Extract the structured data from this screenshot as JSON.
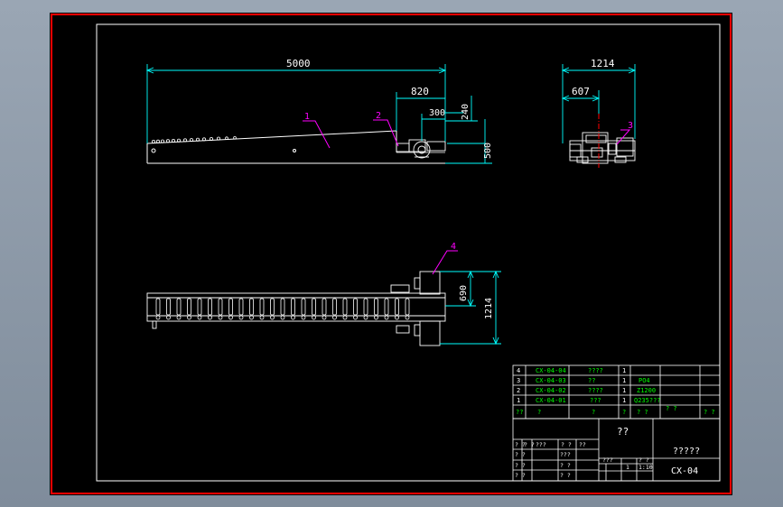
{
  "drawing": {
    "colors": {
      "frame_outer": "#ff0000",
      "frame_inner": "#ffffff",
      "dimension": "#00ffff",
      "leader": "#ff00ff",
      "geometry": "#ffffff",
      "table_text": "#00ff00",
      "background": "#000000"
    },
    "side_view": {
      "dim_length": "5000",
      "dim_820": "820",
      "dim_300": "300",
      "dim_240": "240",
      "dim_500": "500",
      "balloon_1": "1",
      "balloon_2": "2"
    },
    "end_view": {
      "dim_1214": "1214",
      "dim_607": "607",
      "balloon_3": "3"
    },
    "plan_view": {
      "dim_690": "690",
      "dim_1214": "1214",
      "balloon_4": "4"
    },
    "bom": {
      "rows": [
        {
          "no": "4",
          "code": "CX-04-04",
          "name": "????",
          "qty": "1",
          "material": "",
          "note": ""
        },
        {
          "no": "3",
          "code": "CX-04-03",
          "name": "??",
          "qty": "1",
          "material": "PO4",
          "note": ""
        },
        {
          "no": "2",
          "code": "CX-04-02",
          "name": "????",
          "qty": "1",
          "material": "Z1200",
          "note": ""
        },
        {
          "no": "1",
          "code": "CX-04-01",
          "name": "???",
          "qty": "1",
          "material": "Q235???",
          "note": ""
        }
      ],
      "header": {
        "no": "??",
        "code": "?",
        "name": "?",
        "qty": "?",
        "material": "? ?",
        "weight": "? ?",
        "note": "? ?"
      }
    },
    "title_block": {
      "company": "??",
      "drawing_title": "?????",
      "drawing_number": "CX-04",
      "labels_left": [
        "? ?",
        "? ?",
        "??",
        "? ?"
      ],
      "labels_row1": [
        "? ?",
        "? ?",
        "???",
        "? ?",
        "??",
        "? ?"
      ],
      "labels_row2": [
        "? ?",
        "???"
      ],
      "labels_row3": [
        "? ?",
        "? ?"
      ],
      "labels_row4": [
        "? ?",
        "? ?"
      ],
      "scale_label": "???",
      "scale_value": "1:10",
      "qty_label": "? ?",
      "sheet_value": "1"
    }
  }
}
